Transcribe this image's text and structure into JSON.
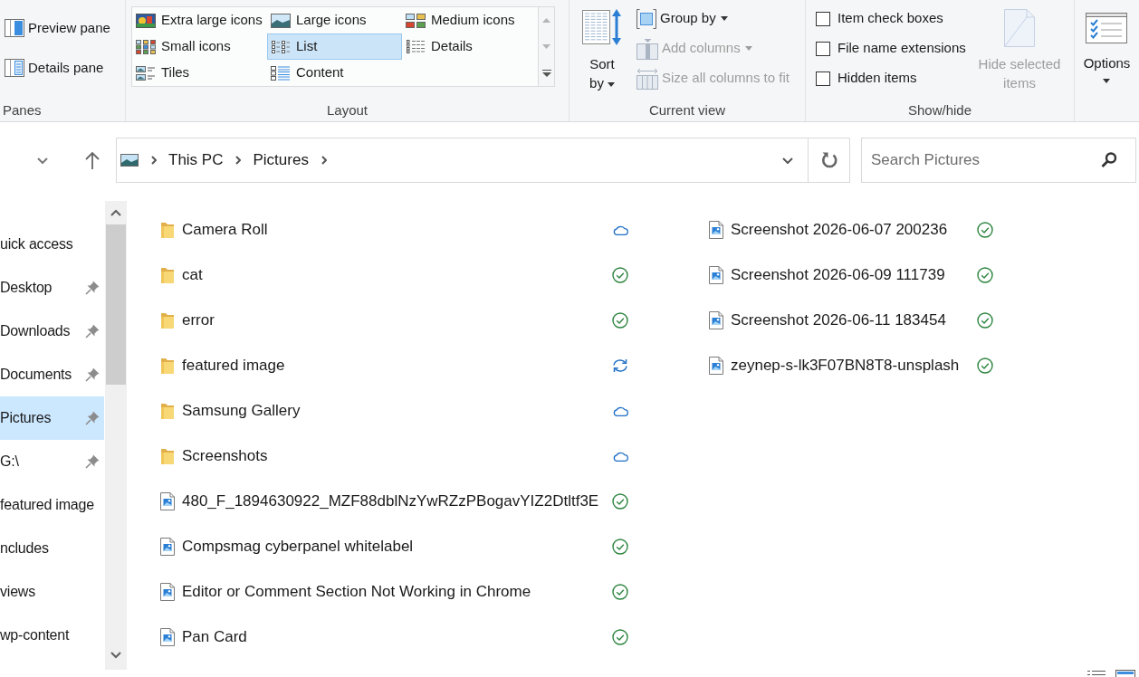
{
  "ribbon": {
    "panes_group": {
      "label": "Panes",
      "buttons": [
        {
          "label": "Preview pane",
          "kind": "preview"
        },
        {
          "label": "Details pane",
          "kind": "details"
        }
      ]
    },
    "layout_group": {
      "label": "Layout",
      "options": [
        {
          "label": "Extra large icons",
          "kind": "extra_large",
          "selected": false
        },
        {
          "label": "Large icons",
          "kind": "large",
          "selected": false
        },
        {
          "label": "Medium icons",
          "kind": "medium",
          "selected": false
        },
        {
          "label": "Small icons",
          "kind": "small",
          "selected": false
        },
        {
          "label": "List",
          "kind": "list",
          "selected": true
        },
        {
          "label": "Details",
          "kind": "details",
          "selected": false
        },
        {
          "label": "Tiles",
          "kind": "tiles",
          "selected": false
        },
        {
          "label": "Content",
          "kind": "content",
          "selected": false
        }
      ]
    },
    "current_view_group": {
      "label": "Current view",
      "sort_by": {
        "label": "Sort by"
      },
      "buttons": [
        {
          "label": "Group by",
          "kind": "group",
          "dropdown": true,
          "disabled": false
        },
        {
          "label": "Add columns",
          "kind": "add_columns",
          "dropdown": true,
          "disabled": true
        },
        {
          "label": "Size all columns to fit",
          "kind": "size_columns",
          "dropdown": false,
          "disabled": true
        }
      ]
    },
    "show_hide_group": {
      "label": "Show/hide",
      "checkboxes": [
        {
          "label": "Item check boxes",
          "checked": false
        },
        {
          "label": "File name extensions",
          "checked": false
        },
        {
          "label": "Hidden items",
          "checked": false
        }
      ],
      "hide_selected": {
        "label": "Hide selected items",
        "disabled": true
      }
    },
    "options": {
      "label": "Options"
    }
  },
  "address_bar": {
    "path": [
      "This PC",
      "Pictures"
    ]
  },
  "search": {
    "placeholder": "Search Pictures"
  },
  "navigation_pane": {
    "items": [
      {
        "label": "uick access",
        "pinned": false,
        "selected": false
      },
      {
        "label": "Desktop",
        "pinned": true,
        "selected": false
      },
      {
        "label": "Downloads",
        "pinned": true,
        "selected": false
      },
      {
        "label": "Documents",
        "pinned": true,
        "selected": false
      },
      {
        "label": "Pictures",
        "pinned": true,
        "selected": true
      },
      {
        "label": "G:\\",
        "pinned": true,
        "selected": false
      },
      {
        "label": "featured image",
        "pinned": false,
        "selected": false
      },
      {
        "label": "ncludes",
        "pinned": false,
        "selected": false
      },
      {
        "label": "views",
        "pinned": false,
        "selected": false
      },
      {
        "label": "wp-content",
        "pinned": false,
        "selected": false
      }
    ]
  },
  "files": [
    {
      "name": "Camera Roll",
      "kind": "folder",
      "status": {
        "kind": "cloud"
      }
    },
    {
      "name": "cat",
      "kind": "folder",
      "status": {
        "kind": "synced"
      }
    },
    {
      "name": "error",
      "kind": "folder",
      "status": {
        "kind": "synced"
      }
    },
    {
      "name": "featured image",
      "kind": "folder",
      "status": {
        "kind": "syncing"
      }
    },
    {
      "name": "Samsung Gallery",
      "kind": "folder",
      "status": {
        "kind": "cloud"
      }
    },
    {
      "name": "Screenshots",
      "kind": "folder",
      "status": {
        "kind": "cloud"
      }
    },
    {
      "name": "480_F_1894630922_MZF88dblNzYwRZzPBogavYIZ2Dtltf3E",
      "kind": "image",
      "status": {
        "kind": "synced"
      }
    },
    {
      "name": "Compsmag cyberpanel whitelabel",
      "kind": "image",
      "status": {
        "kind": "synced"
      }
    },
    {
      "name": "Editor or Comment Section Not Working in Chrome",
      "kind": "image",
      "status": {
        "kind": "synced"
      }
    },
    {
      "name": "Pan Card",
      "kind": "image",
      "status": {
        "kind": "synced"
      }
    },
    {
      "name": "Screenshot 2026-06-07 200236",
      "kind": "image",
      "status": {
        "kind": "synced"
      }
    },
    {
      "name": "Screenshot 2026-06-09 111739",
      "kind": "image",
      "status": {
        "kind": "synced"
      }
    },
    {
      "name": "Screenshot 2026-06-11 183454",
      "kind": "image",
      "status": {
        "kind": "synced"
      }
    },
    {
      "name": "zeynep-s-lk3F07BN8T8-unsplash",
      "kind": "image",
      "status": {
        "kind": "synced"
      }
    }
  ]
}
